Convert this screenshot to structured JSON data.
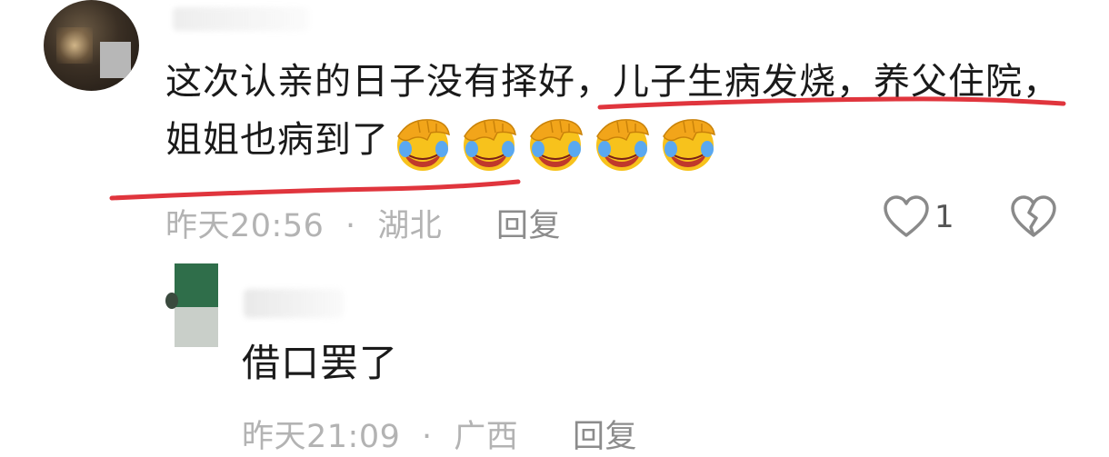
{
  "comment": {
    "text": "这次认亲的日子没有择好，儿子生病发烧，养父住院，姐姐也病到了",
    "emojis": [
      "facepalm-laughing-emoji",
      "facepalm-laughing-emoji",
      "facepalm-laughing-emoji",
      "facepalm-laughing-emoji",
      "facepalm-laughing-emoji"
    ],
    "time": "昨天20:56",
    "separator": "·",
    "location": "湖北",
    "reply_label": "回复",
    "like_count": "1",
    "like_icon": "heart-outline-icon",
    "dislike_icon": "broken-heart-icon",
    "underline_color": "#e0353d"
  },
  "reply": {
    "text": "借口罢了",
    "time": "昨天21:09",
    "separator": "·",
    "location": "广西",
    "reply_label": "回复"
  }
}
